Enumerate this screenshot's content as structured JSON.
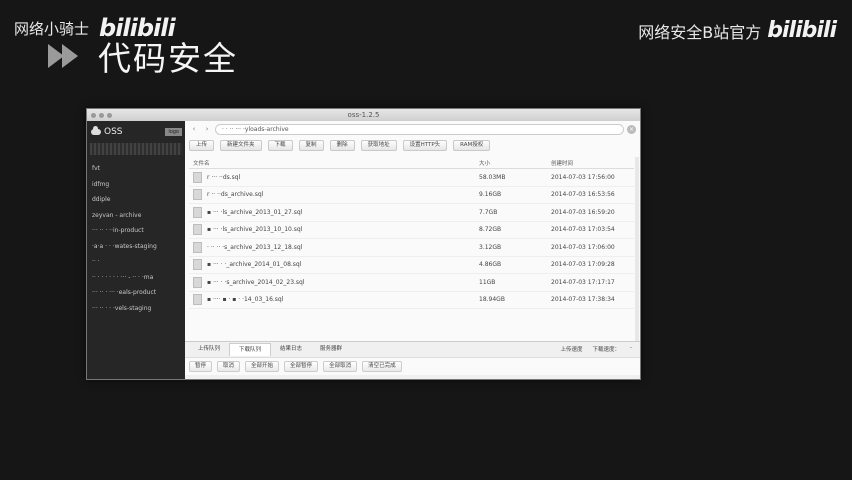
{
  "overlay": {
    "channel_left": "网络小骑士",
    "logo_left": "bilibili",
    "slide_title": "代码安全",
    "channel_right": "网络安全B站官方",
    "logo_right": "bilibili"
  },
  "window": {
    "title": "oss-1.2.5"
  },
  "sidebar": {
    "brand": "OSS",
    "badge": "logo",
    "items": [
      {
        "label": "fvt"
      },
      {
        "label": "idfmg"
      },
      {
        "label": "ddiple"
      },
      {
        "label": "zeyvan - archive"
      },
      {
        "label": "··· ·· · ··in-product"
      },
      {
        "label": "·a·a · · ·wates-staging"
      },
      {
        "label": "·· ·"
      },
      {
        "label": "·· · · · · ·  ·  ··· - ·· · ·ma"
      },
      {
        "label": "··· ·· · ··· ·eals-product"
      },
      {
        "label": "··· ·· · · ·vels-staging"
      }
    ]
  },
  "address": {
    "path": "·  · ·· ··· ·yloads-archive",
    "back": "‹",
    "forward": "›"
  },
  "toolbar": {
    "buttons": [
      "上传",
      "新建文件夹",
      "下载",
      "复制",
      "删除",
      "获取地址",
      "设置HTTP头",
      "RAM授权"
    ]
  },
  "table": {
    "headers": {
      "name": "文件名",
      "size": "大小",
      "time": "创建时间"
    },
    "rows": [
      {
        "name": "r ··· ··ds.sql",
        "size": "58.03MB",
        "time": "2014-07-03 17:56:00"
      },
      {
        "name": "r ·· ··ds_archive.sql",
        "size": "9.16GB",
        "time": "2014-07-03 16:53:56"
      },
      {
        "name": "▪ ··· ·ls_archive_2013_01_27.sql",
        "size": "7.7GB",
        "time": "2014-07-03 16:59:20"
      },
      {
        "name": "▪ ··· ·ls_archive_2013_10_10.sql",
        "size": "8.72GB",
        "time": "2014-07-03 17:03:54"
      },
      {
        "name": "· ·· ·· ·s_archive_2013_12_18.sql",
        "size": "3.12GB",
        "time": "2014-07-03 17:06:00"
      },
      {
        "name": "▪ ··· · ·_archive_2014_01_08.sql",
        "size": "4.86GB",
        "time": "2014-07-03 17:09:28"
      },
      {
        "name": "▪ ··· · ·s_archive_2014_02_23.sql",
        "size": "11GB",
        "time": "2014-07-03 17:17:17"
      },
      {
        "name": "▪ ···· ▪ · ▪ · ·14_03_16.sql",
        "size": "18.94GB",
        "time": "2014-07-03 17:38:34"
      }
    ]
  },
  "bottom": {
    "tabs": [
      "上传队列",
      "下载队列",
      "结果日志",
      "服务器群"
    ],
    "active_tab": 1,
    "right": [
      "上传速度",
      "下载速度：",
      "-"
    ],
    "buttons": [
      "暂停",
      "取消",
      "全部开始",
      "全部暂停",
      "全部取消",
      "清空已完成"
    ]
  }
}
